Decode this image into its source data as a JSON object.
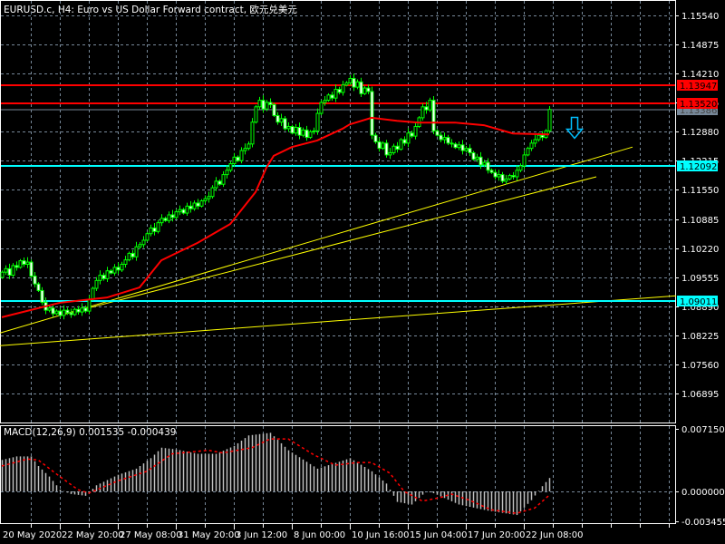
{
  "window": {
    "title": "EURUSD.c, H4:  Euro vs US Dollar Forward contract, 欧元兑美元"
  },
  "colors": {
    "background": "#000000",
    "grid": "#778899",
    "candle_outline": "#00ff00",
    "bull_body": "#000000",
    "bear_body": "#ffffff",
    "moving_average": "#ff0000",
    "resistance": "#ff0000",
    "support": "#00ffff",
    "trendline": "#ffff00",
    "macd_histogram": "#c0c0c0",
    "macd_signal": "#ff0000",
    "bid_line": "#778899",
    "arrow": "#00bfff"
  },
  "chart_data": [
    {
      "type": "candlestick",
      "title": "EURUSD.c, H4",
      "price_ticks": [
        "1.15540",
        "1.14875",
        "1.14210",
        "1.13545",
        "1.12880",
        "1.12215",
        "1.11550",
        "1.10885",
        "1.10220",
        "1.09555",
        "1.08890",
        "1.08225",
        "1.07560",
        "1.06895"
      ],
      "time_labels": [
        "20 May 2020",
        "22 May 20:00",
        "27 May 08:00",
        "31 May 20:00",
        "3 Jun 12:00",
        "8 Jun 00:00",
        "10 Jun 16:00",
        "15 Jun 04:00",
        "17 Jun 20:00",
        "22 Jun 08:00"
      ],
      "grid": true,
      "close": [
        1.0967,
        1.0975,
        1.096,
        1.0982,
        1.0978,
        1.0993,
        1.0985,
        1.099,
        1.0958,
        1.094,
        1.0925,
        1.0898,
        1.088,
        1.0885,
        1.0872,
        1.0878,
        1.0868,
        1.088,
        1.0874,
        1.087,
        1.0882,
        1.0876,
        1.0885,
        1.0878,
        1.0905,
        1.093,
        1.0948,
        1.096,
        1.0952,
        1.097,
        1.0965,
        1.0978,
        1.0972,
        1.0985,
        1.0995,
        1.101,
        1.1002,
        1.1025,
        1.103,
        1.104,
        1.1055,
        1.1068,
        1.106,
        1.108,
        1.109,
        1.1085,
        1.1098,
        1.1092,
        1.1105,
        1.111,
        1.1102,
        1.1118,
        1.1112,
        1.1125,
        1.1118,
        1.113,
        1.1135,
        1.114,
        1.116,
        1.1175,
        1.1168,
        1.119,
        1.12,
        1.1215,
        1.123,
        1.1222,
        1.1245,
        1.125,
        1.126,
        1.131,
        1.1345,
        1.136,
        1.134,
        1.1355,
        1.135,
        1.1325,
        1.131,
        1.1318,
        1.1295,
        1.13,
        1.1285,
        1.1298,
        1.128,
        1.1292,
        1.1275,
        1.1288,
        1.129,
        1.133,
        1.1355,
        1.136,
        1.1372,
        1.1365,
        1.1385,
        1.1378,
        1.1395,
        1.14,
        1.141,
        1.139,
        1.1402,
        1.1375,
        1.1388,
        1.138,
        1.128,
        1.1265,
        1.125,
        1.1262,
        1.1235,
        1.124,
        1.1255,
        1.1248,
        1.127,
        1.1262,
        1.1285,
        1.1278,
        1.13,
        1.132,
        1.1345,
        1.1338,
        1.136,
        1.129,
        1.128,
        1.127,
        1.1275,
        1.1262,
        1.126,
        1.1252,
        1.1258,
        1.1245,
        1.125,
        1.124,
        1.1225,
        1.123,
        1.1212,
        1.1218,
        1.12,
        1.1195,
        1.1185,
        1.119,
        1.1175,
        1.118,
        1.1188,
        1.1185,
        1.12,
        1.121,
        1.1235,
        1.125,
        1.1262,
        1.127,
        1.128,
        1.1275,
        1.129,
        1.1339
      ],
      "moving_average": [
        [
          0,
          1.0864
        ],
        [
          16,
          1.0897
        ],
        [
          29,
          1.0909
        ],
        [
          38,
          1.0932
        ],
        [
          44,
          1.0994
        ],
        [
          54,
          1.1034
        ],
        [
          63,
          1.1077
        ],
        [
          70,
          1.115
        ],
        [
          73,
          1.1206
        ],
        [
          75,
          1.1233
        ],
        [
          80,
          1.1253
        ],
        [
          87,
          1.1268
        ],
        [
          94,
          1.1295
        ],
        [
          96,
          1.1305
        ],
        [
          102,
          1.132
        ],
        [
          109,
          1.1313
        ],
        [
          115,
          1.1309
        ],
        [
          125,
          1.1309
        ],
        [
          133,
          1.1303
        ],
        [
          141,
          1.1284
        ],
        [
          151,
          1.1282
        ]
      ],
      "horizontal_lines": [
        {
          "price": 1.13947,
          "label": "1.13947",
          "kind": "resistance"
        },
        {
          "price": 1.1352,
          "label": "1.13520",
          "kind": "resistance"
        },
        {
          "price": 1.13386,
          "label": "1.13386",
          "kind": "bid_line"
        },
        {
          "price": 1.12092,
          "label": "1.12092",
          "kind": "support"
        },
        {
          "price": 1.09011,
          "label": "1.09011",
          "kind": "support"
        }
      ],
      "trendlines": [
        {
          "from": [
            -0.5,
            1.0828
          ],
          "to": [
            174,
            1.1253
          ]
        },
        {
          "from": [
            16,
            1.0868
          ],
          "to": [
            164,
            1.1185
          ]
        },
        {
          "from": [
            -0.5,
            1.0799
          ],
          "to": [
            186,
            1.0913
          ]
        }
      ],
      "annotations": [
        {
          "type": "down-arrow",
          "bar": 158,
          "price": 1.1325
        }
      ]
    },
    {
      "type": "bar",
      "title": "MACD(12,26,9)",
      "main_value": "0.001535",
      "signal_value": "-0.000439",
      "y_ticks": [
        "0.007150",
        "0.000000",
        "-0.003455"
      ],
      "ylim": [
        -0.003455,
        0.00715
      ],
      "main": [
        [
          0,
          0.0036
        ],
        [
          4,
          0.004
        ],
        [
          8,
          0.004
        ],
        [
          10,
          0.0029
        ],
        [
          13,
          0.0017
        ],
        [
          16,
          0.0002
        ],
        [
          19,
          -0.0003
        ],
        [
          23,
          -0.0005
        ],
        [
          26,
          0.0007
        ],
        [
          32,
          0.0019
        ],
        [
          37,
          0.0026
        ],
        [
          41,
          0.0038
        ],
        [
          44,
          0.005
        ],
        [
          48,
          0.0048
        ],
        [
          54,
          0.0043
        ],
        [
          59,
          0.0043
        ],
        [
          64,
          0.0052
        ],
        [
          68,
          0.0064
        ],
        [
          74,
          0.0067
        ],
        [
          79,
          0.0047
        ],
        [
          87,
          0.0026
        ],
        [
          96,
          0.0038
        ],
        [
          102,
          0.0023
        ],
        [
          106,
          0.0009
        ],
        [
          109,
          -0.0012
        ],
        [
          113,
          -0.0015
        ],
        [
          117,
          0.0
        ],
        [
          119,
          -0.0002
        ],
        [
          126,
          -0.0015
        ],
        [
          134,
          -0.0022
        ],
        [
          142,
          -0.0027
        ],
        [
          146,
          -0.001
        ],
        [
          149,
          0.0006
        ],
        [
          151,
          0.001535
        ]
      ],
      "signal": [
        [
          0,
          0.0029
        ],
        [
          7,
          0.0037
        ],
        [
          10,
          0.0036
        ],
        [
          16,
          0.0017
        ],
        [
          21,
          0.0002
        ],
        [
          24,
          -0.0002
        ],
        [
          32,
          0.0012
        ],
        [
          40,
          0.0023
        ],
        [
          47,
          0.0043
        ],
        [
          57,
          0.0047
        ],
        [
          61,
          0.0044
        ],
        [
          69,
          0.005
        ],
        [
          74,
          0.006
        ],
        [
          79,
          0.006
        ],
        [
          86,
          0.0042
        ],
        [
          92,
          0.003
        ],
        [
          98,
          0.0033
        ],
        [
          102,
          0.0033
        ],
        [
          107,
          0.0021
        ],
        [
          111,
          0.0
        ],
        [
          116,
          -0.0011
        ],
        [
          121,
          -0.0007
        ],
        [
          124,
          -0.0003
        ],
        [
          129,
          -0.001
        ],
        [
          135,
          -0.0021
        ],
        [
          142,
          -0.0025
        ],
        [
          147,
          -0.0019
        ],
        [
          151,
          -0.000439
        ]
      ]
    }
  ]
}
